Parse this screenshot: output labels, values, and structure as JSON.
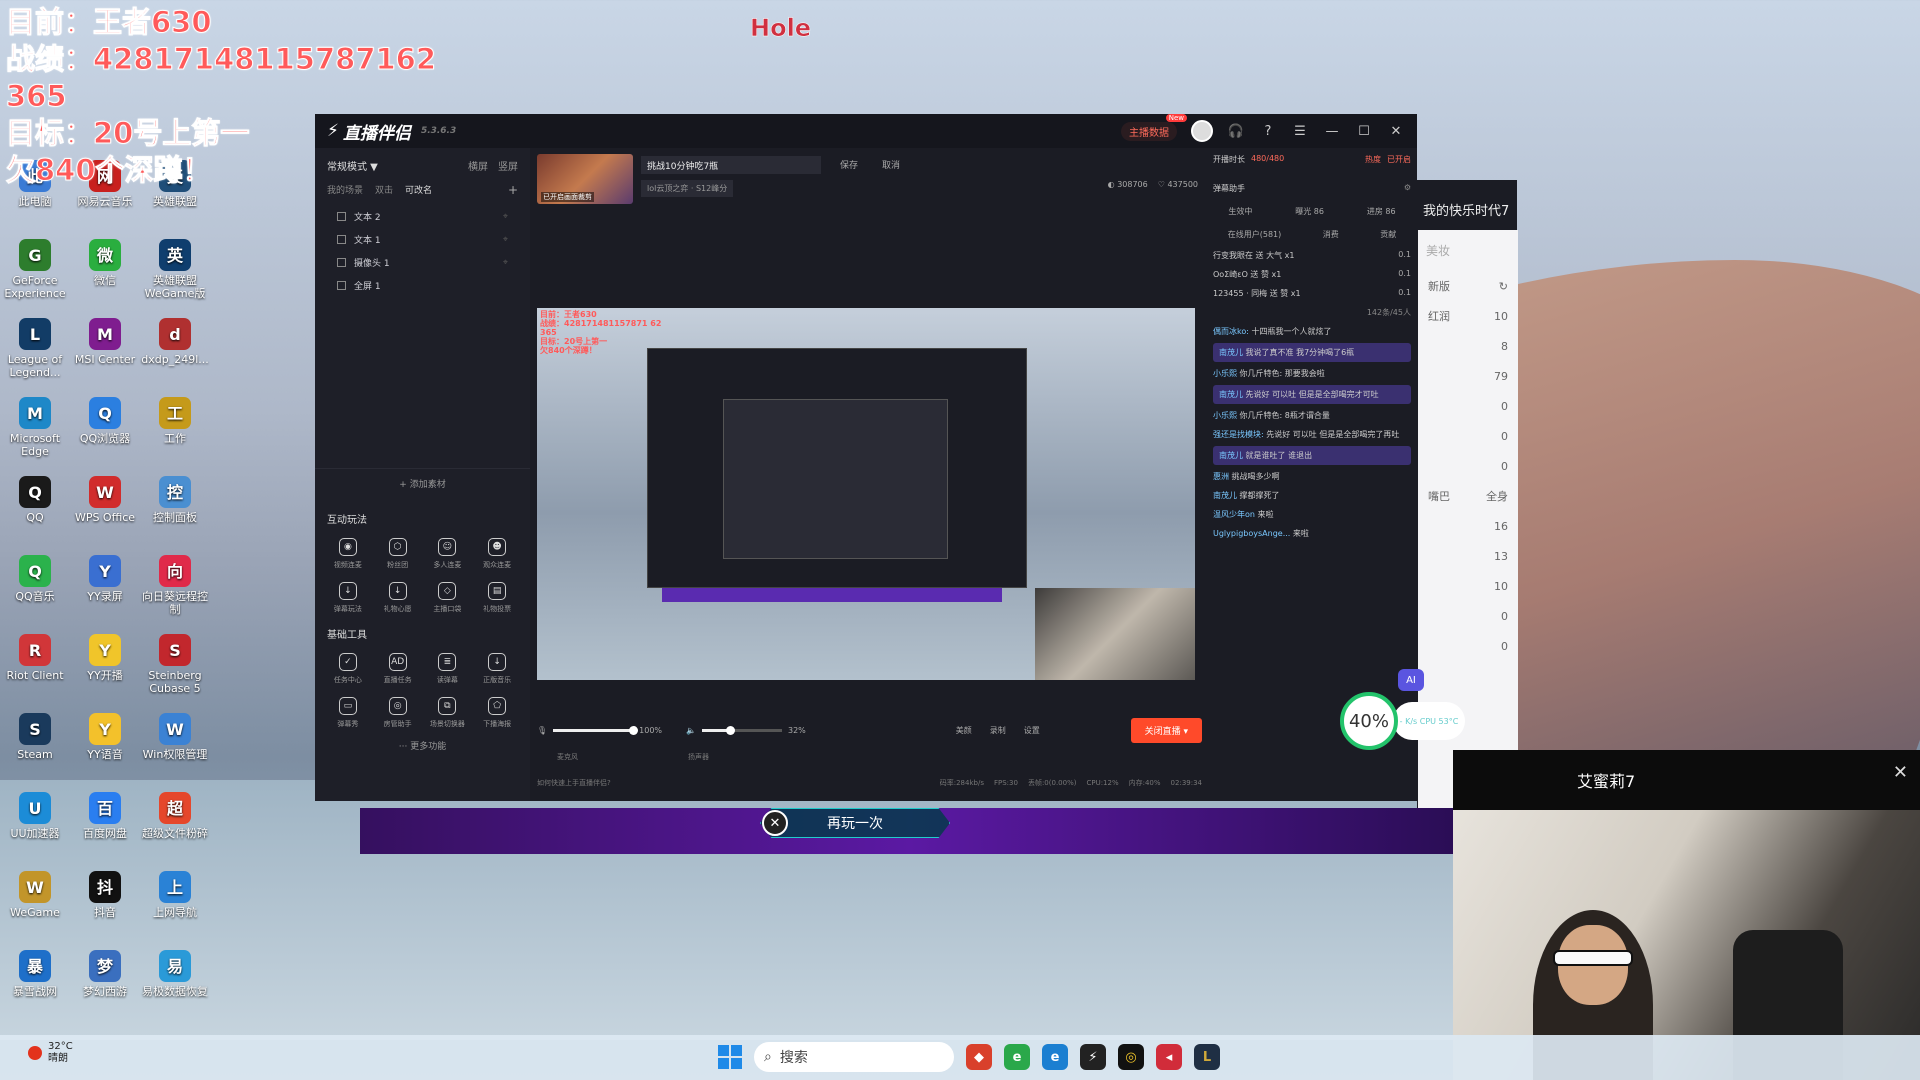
{
  "overlay": {
    "lines": [
      "目前：王者630",
      "战绩：428171481157871​62",
      "365",
      "目标：20号上第一",
      "欠840个深蹲！"
    ],
    "hole": "Hole"
  },
  "desktop_icons": [
    {
      "label": "此电脑",
      "color": "#3a7bd5"
    },
    {
      "label": "网易云音乐",
      "color": "#c8201e"
    },
    {
      "label": "英雄联盟",
      "color": "#1f4e79"
    },
    {
      "label": "GeForce Experience",
      "color": "#2d7d2d"
    },
    {
      "label": "微信",
      "color": "#2aae3f"
    },
    {
      "label": "英雄联盟 WeGame版",
      "color": "#0f3e6e"
    },
    {
      "label": "League of Legend...",
      "color": "#123c66"
    },
    {
      "label": "MSI Center",
      "color": "#7f1d8f"
    },
    {
      "label": "dxdp_249l...",
      "color": "#b03030"
    },
    {
      "label": "Microsoft Edge",
      "color": "#1e88c8"
    },
    {
      "label": "QQ浏览器",
      "color": "#2b7fe0"
    },
    {
      "label": "工作",
      "color": "#c59a1a"
    },
    {
      "label": "QQ",
      "color": "#1a1a1a"
    },
    {
      "label": "WPS Office",
      "color": "#d12c2c"
    },
    {
      "label": "控制面板",
      "color": "#4a8fd1"
    },
    {
      "label": "QQ音乐",
      "color": "#2bb24c"
    },
    {
      "label": "YY录屏",
      "color": "#3a6fd1"
    },
    {
      "label": "向日葵远程控制",
      "color": "#e02a4a"
    },
    {
      "label": "Riot Client",
      "color": "#d13639"
    },
    {
      "label": "YY开播",
      "color": "#f0c52a"
    },
    {
      "label": "Steinberg Cubase 5",
      "color": "#c2272d"
    },
    {
      "label": "Steam",
      "color": "#1a3a5c"
    },
    {
      "label": "YY语音",
      "color": "#f3c12b"
    },
    {
      "label": "Win权限管理",
      "color": "#3b82d4"
    },
    {
      "label": "UU加速器",
      "color": "#1c8cd7"
    },
    {
      "label": "百度网盘",
      "color": "#2a7ef0"
    },
    {
      "label": "超级文件粉碎",
      "color": "#e5472b"
    },
    {
      "label": "WeGame",
      "color": "#c2952a"
    },
    {
      "label": "抖音",
      "color": "#111111"
    },
    {
      "label": "上网导航",
      "color": "#2a82d6"
    },
    {
      "label": "暴雪战网",
      "color": "#1e6fc9"
    },
    {
      "label": "梦幻西游",
      "color": "#3a6fbf"
    },
    {
      "label": "易极数据恢复",
      "color": "#2a9ad8"
    }
  ],
  "app": {
    "name": "直播伴侣",
    "version": "5.3.6.3",
    "live_data": "主播数据",
    "new_tag": "New",
    "left": {
      "mode": "常规模式 ▼",
      "mode_right": [
        "横屏",
        "竖屏"
      ],
      "scene_tabs": [
        "我的场景",
        "双击",
        "可改名",
        "+"
      ],
      "sources": [
        "文本 2",
        "文本 1",
        "摄像头 1",
        "全屏 1"
      ],
      "add_material": "+ 添加素材",
      "interactive_title": "互动玩法",
      "interactive_tools": [
        "视频连麦",
        "粉丝团",
        "多人连麦",
        "观众连麦",
        "弹幕玩法",
        "礼物心愿",
        "主播口袋",
        "礼物投票"
      ],
      "basic_title": "基础工具",
      "basic_tools": [
        "任务中心",
        "直播任务",
        "读弹幕",
        "正版音乐",
        "弹幕秀",
        "房管助手",
        "场景切换器",
        "下播海报"
      ],
      "more": "··· 更多功能"
    },
    "center": {
      "thumb_label": "已开启画面裁剪",
      "title_value": "挑战10分钟吃7瓶",
      "save": "保存",
      "cancel": "取消",
      "category": "lol云顶之弈 · S12峰分",
      "viewers": "308706",
      "likes": "437500",
      "preview_text": "目前：王者630\n战绩：428171481157871 62\n365\n目标：20号上第一\n欠840个深蹲！",
      "mic_label": "麦克风",
      "mic_pct": "100%",
      "speaker_label": "扬声器",
      "speaker_pct": "32%",
      "btn_beauty": "美颜",
      "btn_record": "录制",
      "btn_settings": "设置",
      "go_live": "关闭直播 ▾",
      "hint": "如何快速上手直播伴侣?",
      "status": [
        "码率:284kb/s",
        "FPS:30",
        "丢帧:0(0.00%)",
        "CPU:12%",
        "内存:40%",
        "02:39:34"
      ]
    },
    "right": {
      "live_duration": "开播时长",
      "duration_value": "480/480",
      "heat": "热度",
      "open_label": "已开启",
      "assistant": "弹幕助手",
      "tabs": [
        "生效中",
        "曝光 86",
        "进房 86"
      ],
      "subtabs": [
        "在线用户(581)",
        "消费",
        "贡献"
      ],
      "gifts": [
        {
          "text": "行变我眼在 送 大气 x1",
          "amt": "0.1"
        },
        {
          "text": "OoΣ崎εO 送 赞 x1",
          "amt": "0.1"
        },
        {
          "text": "123455 · 同梅 送 赞 x1",
          "amt": "0.1"
        }
      ],
      "count": "142条/45人",
      "messages": [
        {
          "user": "偶而冰ko:",
          "text": "十四瓶我一个人就炫了",
          "hl": false
        },
        {
          "user": "南茂儿",
          "text": "我说了真不准 我7分钟喝了6瓶",
          "hl": true
        },
        {
          "user": "小乐熙",
          "text": "你几斤特色: 那要我会啦",
          "hl": false
        },
        {
          "user": "南茂儿",
          "text": "先说好 可以吐 但是是全部喝完才可吐",
          "hl": true
        },
        {
          "user": "小乐熙",
          "text": "你几斤特色: 8瓶才谓合量",
          "hl": false
        },
        {
          "user": "强还是找模块:",
          "text": "先说好 可以吐 但是是全部喝完了再吐",
          "hl": false
        },
        {
          "user": "南茂儿",
          "text": "就是谁吐了 谁退出",
          "hl": true
        },
        {
          "user": "惠洲",
          "text": "挑战喝多少啊",
          "hl": false
        },
        {
          "user": "南茂儿",
          "text": "撑都撑死了",
          "hl": false
        },
        {
          "user": "温风少年on",
          "text": "来啦",
          "hl": false
        },
        {
          "user": "UglypigboysAnge...",
          "text": "来啦",
          "hl": false
        }
      ]
    }
  },
  "side_window": {
    "title": "我的快乐时代7",
    "beauty": "美妆",
    "version_sel": "新版",
    "rows": [
      {
        "label": "红润",
        "value": "10"
      },
      {
        "label": "",
        "value": "8"
      },
      {
        "label": "",
        "value": "79"
      },
      {
        "label": "",
        "value": "0"
      },
      {
        "label": "",
        "value": "0"
      },
      {
        "label": "",
        "value": "0"
      },
      {
        "label": "嘴巴",
        "value": "全身"
      },
      {
        "label": "",
        "value": "16"
      },
      {
        "label": "",
        "value": "13"
      },
      {
        "label": "",
        "value": "10"
      },
      {
        "label": "",
        "value": "0"
      },
      {
        "label": "",
        "value": "0"
      }
    ]
  },
  "replay": "再玩一次",
  "cam": {
    "title": "艾蜜莉7"
  },
  "meter": {
    "pct": "40%",
    "cpu": "CPU 53°C",
    "net": "- K/s",
    "ai": "AI"
  },
  "taskbar": {
    "temp": "32°C",
    "weather": "晴朗",
    "search": "搜索"
  }
}
